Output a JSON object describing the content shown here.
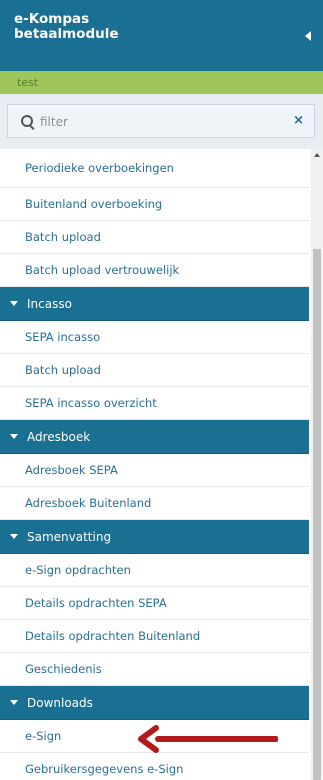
{
  "header": {
    "title": "e-Kompas betaalmodule"
  },
  "user_bar": {
    "name": "test"
  },
  "filter": {
    "placeholder": "filter",
    "clear_label": "×"
  },
  "menu": {
    "payments": [
      "Periodieke overboekingen",
      "Buitenland overboeking",
      "Batch upload",
      "Batch upload vertrouwelijk"
    ],
    "incasso": {
      "title": "Incasso",
      "items": [
        "SEPA incasso",
        "Batch upload",
        "SEPA incasso overzicht"
      ]
    },
    "adresboek": {
      "title": "Adresboek",
      "items": [
        "Adresboek SEPA",
        "Adresboek Buitenland"
      ]
    },
    "samenvatting": {
      "title": "Samenvatting",
      "items": [
        "e-Sign opdrachten",
        "Details opdrachten SEPA",
        "Details opdrachten Buitenland",
        "Geschiedenis"
      ]
    },
    "downloads": {
      "title": "Downloads",
      "items": [
        "e-Sign",
        "Gebruikersgegevens e-Sign"
      ]
    }
  },
  "colors": {
    "header_bg": "#1a7093",
    "user_bar_bg": "#9fc65a",
    "link_text": "#2a6f95",
    "annotation_arrow": "#b01c1c"
  },
  "icons": {
    "collapse": "caret-left-icon",
    "search": "search-icon",
    "clear": "close-icon",
    "section": "caret-down-icon",
    "annotation": "red-arrow-pointing-left"
  }
}
